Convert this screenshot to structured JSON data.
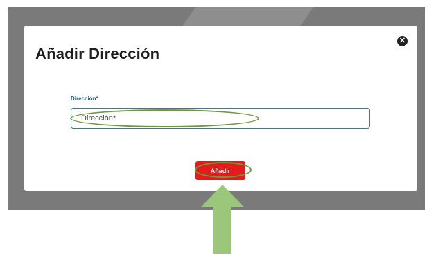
{
  "modal": {
    "title": "Añadir Dirección",
    "close_icon": "close-icon",
    "field": {
      "label": "Dirección*",
      "placeholder": "Dirección*",
      "value": ""
    },
    "add_button_label": "Añadir"
  },
  "annotations": {
    "highlight_color": "#6e9a3c",
    "arrow_color": "#9bc77a",
    "arrow_icon": "up-arrow-icon"
  },
  "colors": {
    "overlay": "#7a7a7a",
    "modal_background": "#ffffff",
    "primary_button": "#e31b1b",
    "label": "#1f5d7a",
    "input_border": "#3a7a8c"
  }
}
